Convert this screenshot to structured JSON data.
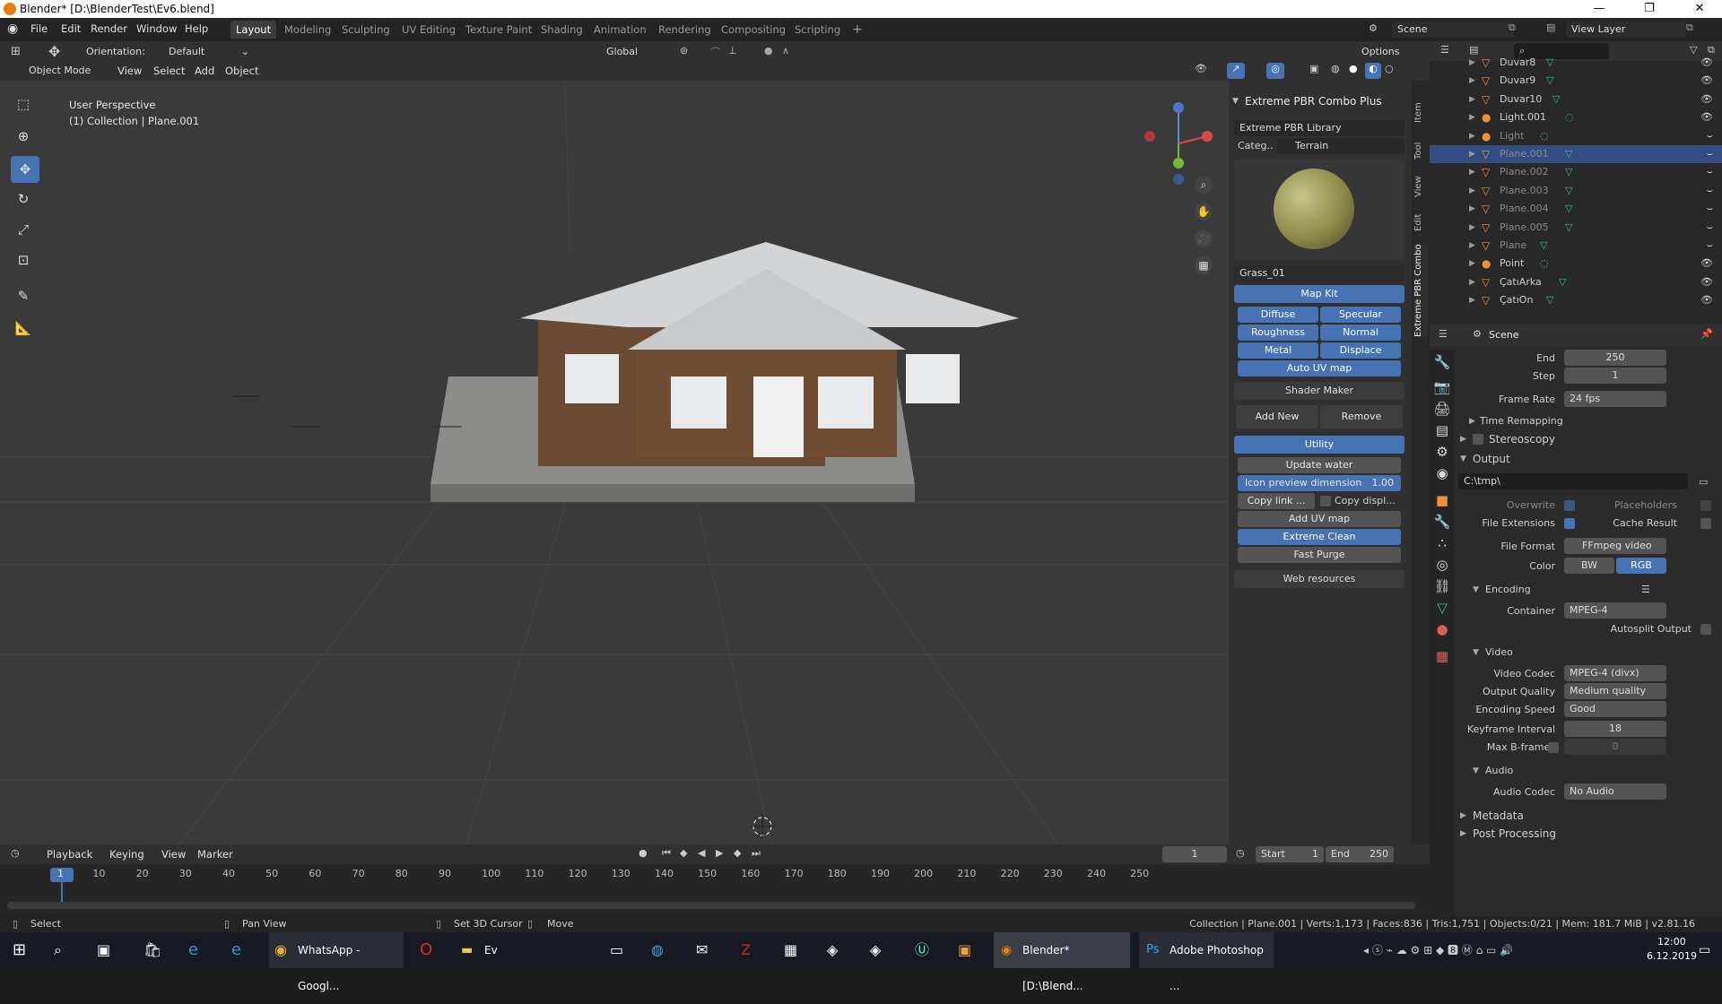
{
  "window": {
    "title": "Blender* [D:\\BlenderTest\\Ev6.blend]",
    "min": "—",
    "max": "❐",
    "close": "✕"
  },
  "menu": [
    "File",
    "Edit",
    "Render",
    "Window",
    "Help"
  ],
  "workspaces": [
    "Layout",
    "Modeling",
    "Sculpting",
    "UV Editing",
    "Texture Paint",
    "Shading",
    "Animation",
    "Rendering",
    "Compositing",
    "Scripting"
  ],
  "active_workspace": "Layout",
  "add_tab": "+",
  "scene_field": "Scene",
  "view_layer_field": "View Layer",
  "header": {
    "orientation_label": "Orientation:",
    "orientation_value": "Default",
    "transform": "Global",
    "options": "Options",
    "mode": "Object Mode",
    "view": "View",
    "select": "Select",
    "add": "Add",
    "object": "Object"
  },
  "viewport": {
    "perspective": "User Perspective",
    "collection": "(1) Collection | Plane.001"
  },
  "npanel": {
    "title": "Extreme PBR Combo Plus",
    "library": "Extreme PBR Library",
    "categ_label": "Categ..",
    "categ_value": "Terrain",
    "material_name": "Grass_01",
    "mapkit": "Map Kit",
    "maps": [
      "Diffuse",
      "Specular",
      "Roughness",
      "Normal",
      "Metal",
      "Displace"
    ],
    "auto_uv": "Auto UV map",
    "shader_maker": "Shader Maker",
    "add_new": "Add New",
    "remove": "Remove",
    "utility": "Utility",
    "update_water": "Update water",
    "icon_preview_label": "Icon preview dimension",
    "icon_preview_value": "1.00",
    "copy_link": "Copy link ...",
    "copy_displ": "Copy displ...",
    "add_uv_map": "Add UV map",
    "extreme_clean": "Extreme Clean",
    "fast_purge": "Fast Purge",
    "web_resources": "Web resources"
  },
  "vtabs": [
    "Item",
    "Tool",
    "View",
    "Edit",
    "Extreme PBR Combo"
  ],
  "outliner": [
    {
      "name": "Duvar8",
      "type": "mesh",
      "dim": false,
      "sel": false
    },
    {
      "name": "Duvar9",
      "type": "mesh",
      "dim": false,
      "sel": false
    },
    {
      "name": "Duvar10",
      "type": "mesh",
      "dim": false,
      "sel": false
    },
    {
      "name": "Light.001",
      "type": "light",
      "dim": false,
      "sel": false
    },
    {
      "name": "Light",
      "type": "light",
      "dim": true,
      "sel": false
    },
    {
      "name": "Plane.001",
      "type": "mesh",
      "dim": true,
      "sel": true
    },
    {
      "name": "Plane.002",
      "type": "mesh",
      "dim": true,
      "sel": false
    },
    {
      "name": "Plane.003",
      "type": "mesh",
      "dim": true,
      "sel": false
    },
    {
      "name": "Plane.004",
      "type": "mesh",
      "dim": true,
      "sel": false
    },
    {
      "name": "Plane.005",
      "type": "mesh",
      "dim": true,
      "sel": false
    },
    {
      "name": "Plane",
      "type": "mesh",
      "dim": true,
      "sel": false
    },
    {
      "name": "Point",
      "type": "light",
      "dim": false,
      "sel": false
    },
    {
      "name": "ÇatıArka",
      "type": "mesh",
      "dim": false,
      "sel": false
    },
    {
      "name": "ÇatıOn",
      "type": "mesh",
      "dim": false,
      "sel": false
    }
  ],
  "props": {
    "context": "Scene",
    "end_label": "End",
    "end_value": "250",
    "step_label": "Step",
    "step_value": "1",
    "frame_rate_label": "Frame Rate",
    "frame_rate_value": "24 fps",
    "time_remapping": "Time Remapping",
    "stereoscopy": "Stereoscopy",
    "output": "Output",
    "path": "C:\\tmp\\",
    "overwrite": "Overwrite",
    "placeholders": "Placeholders",
    "file_extensions": "File Extensions",
    "cache_result": "Cache Result",
    "file_format_label": "File Format",
    "file_format_value": "FFmpeg video",
    "color_label": "Color",
    "color_bw": "BW",
    "color_rgb": "RGB",
    "encoding": "Encoding",
    "container_label": "Container",
    "container_value": "MPEG-4",
    "autosplit": "Autosplit Output",
    "video": "Video",
    "video_codec_label": "Video Codec",
    "video_codec_value": "MPEG-4 (divx)",
    "output_quality_label": "Output Quality",
    "output_quality_value": "Medium quality",
    "encoding_speed_label": "Encoding Speed",
    "encoding_speed_value": "Good",
    "keyframe_label": "Keyframe Interval",
    "keyframe_value": "18",
    "max_b_label": "Max B-frames",
    "max_b_value": "0",
    "audio": "Audio",
    "audio_codec_label": "Audio Codec",
    "audio_codec_value": "No Audio",
    "metadata": "Metadata",
    "post_processing": "Post Processing"
  },
  "timeline": {
    "playback": "Playback",
    "keying": "Keying",
    "view": "View",
    "marker": "Marker",
    "current_frame": "1",
    "start_label": "Start",
    "start_value": "1",
    "end_label": "End",
    "end_value": "250",
    "ticks": [
      "1",
      "10",
      "20",
      "30",
      "40",
      "50",
      "60",
      "70",
      "80",
      "90",
      "100",
      "110",
      "120",
      "130",
      "140",
      "150",
      "160",
      "170",
      "180",
      "190",
      "200",
      "210",
      "220",
      "230",
      "240",
      "250"
    ]
  },
  "status": {
    "select": "Select",
    "pan_view": "Pan View",
    "set_cursor": "Set 3D Cursor",
    "move": "Move",
    "stats": "Collection | Plane.001 | Verts:1,173 | Faces:836 | Tris:1,751 | Objects:0/21 | Mem: 181.7 MiB | v2.81.16"
  },
  "taskbar": {
    "whatsapp": "WhatsApp - Googl...",
    "ev": "Ev",
    "blender": "Blender* [D:\\Blend...",
    "photoshop": "Adobe Photoshop ...",
    "time": "12:00",
    "date": "6.12.2019"
  },
  "colors": {
    "accent": "#4772b3",
    "blender_orange": "#e87d0d",
    "mesh_icon": "#e8923a",
    "data_icon": "#2fc2a0"
  }
}
